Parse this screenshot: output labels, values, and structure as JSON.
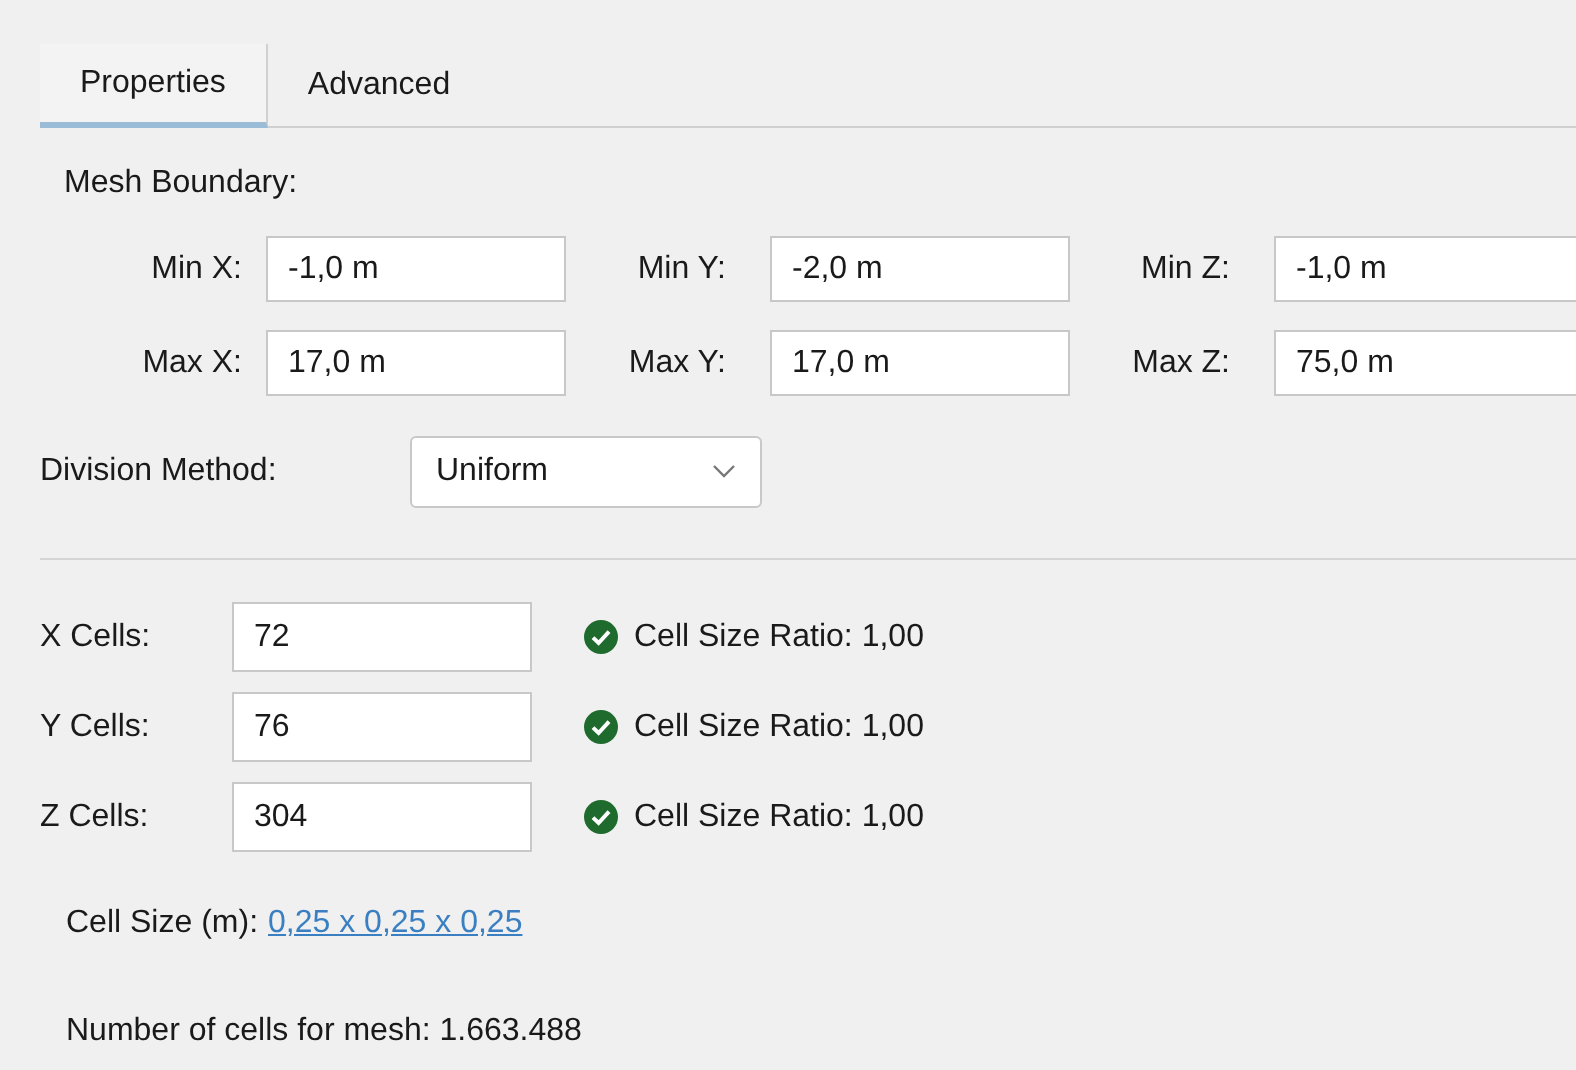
{
  "tabs": [
    {
      "label": "Properties",
      "selected": true
    },
    {
      "label": "Advanced",
      "selected": false
    }
  ],
  "mesh_boundary": {
    "title": "Mesh Boundary:",
    "rows": [
      [
        {
          "label": "Min X:",
          "value": "-1,0 m"
        },
        {
          "label": "Min Y:",
          "value": "-2,0 m"
        },
        {
          "label": "Min Z:",
          "value": "-1,0 m"
        }
      ],
      [
        {
          "label": "Max X:",
          "value": "17,0 m"
        },
        {
          "label": "Max Y:",
          "value": "17,0 m"
        },
        {
          "label": "Max Z:",
          "value": "75,0 m"
        }
      ]
    ]
  },
  "division_method": {
    "label": "Division Method:",
    "value": "Uniform"
  },
  "cells": [
    {
      "label": "X Cells:",
      "value": "72",
      "valid": true,
      "ratio": "Cell Size Ratio: 1,00"
    },
    {
      "label": "Y Cells:",
      "value": "76",
      "valid": true,
      "ratio": "Cell Size Ratio: 1,00"
    },
    {
      "label": "Z Cells:",
      "value": "304",
      "valid": true,
      "ratio": "Cell Size Ratio: 1,00"
    }
  ],
  "cell_size": {
    "label": "Cell Size (m):",
    "link": "0,25 x 0,25 x 0,25"
  },
  "total": "Number of cells for mesh: 1.663.488"
}
